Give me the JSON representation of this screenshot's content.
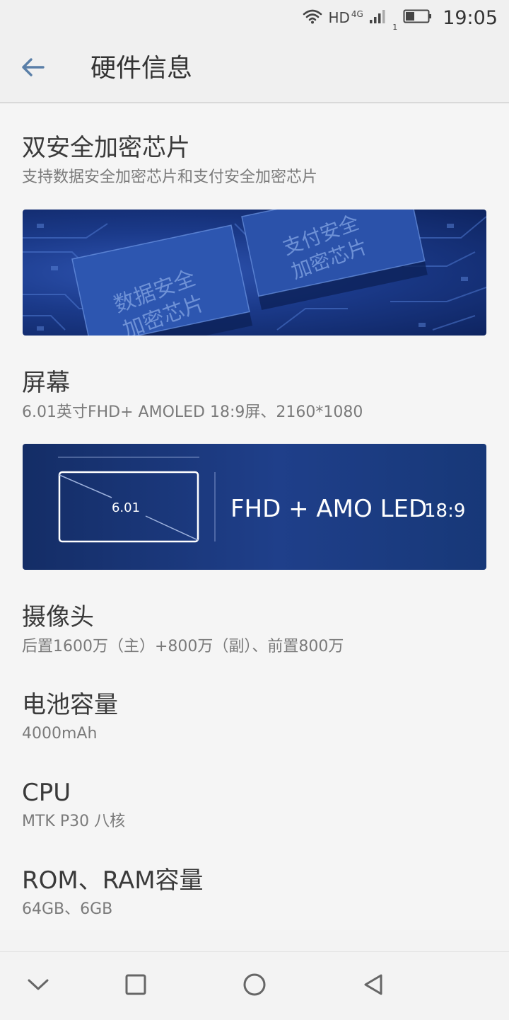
{
  "status_bar": {
    "network": "HD",
    "network_type": "4G",
    "sim_slot": "1",
    "time": "19:05",
    "icons": [
      "wifi-icon",
      "signal-icon",
      "battery-icon"
    ]
  },
  "app_bar": {
    "title": "硬件信息",
    "back_icon": "arrow-left-icon"
  },
  "sections": [
    {
      "title": "双安全加密芯片",
      "subtitle": "支持数据安全加密芯片和支付安全加密芯片"
    },
    {
      "title": "屏幕",
      "subtitle": "6.01英寸FHD+ AMOLED 18:9屏、2160*1080"
    },
    {
      "title": "摄像头",
      "subtitle": "后置1600万（主）+800万（副）、前置800万"
    },
    {
      "title": "电池容量",
      "subtitle": "4000mAh"
    },
    {
      "title": "CPU",
      "subtitle": "MTK  P30 八核"
    },
    {
      "title": "ROM、RAM容量",
      "subtitle": "64GB、6GB"
    }
  ],
  "chip_banner": {
    "chip_left": [
      "数据安全",
      "加密芯片"
    ],
    "chip_right": [
      "支付安全",
      "加密芯片"
    ]
  },
  "screen_banner": {
    "size_label": "6.01",
    "tech_label": "FHD + AMO LED",
    "ratio_label": "18:9"
  },
  "nav_bar": {
    "icons": [
      "chevron-down-icon",
      "square-icon",
      "circle-icon",
      "triangle-back-icon"
    ]
  },
  "colors": {
    "accent": "#5a7fa8",
    "banner_blue": "#1b3a8a"
  }
}
